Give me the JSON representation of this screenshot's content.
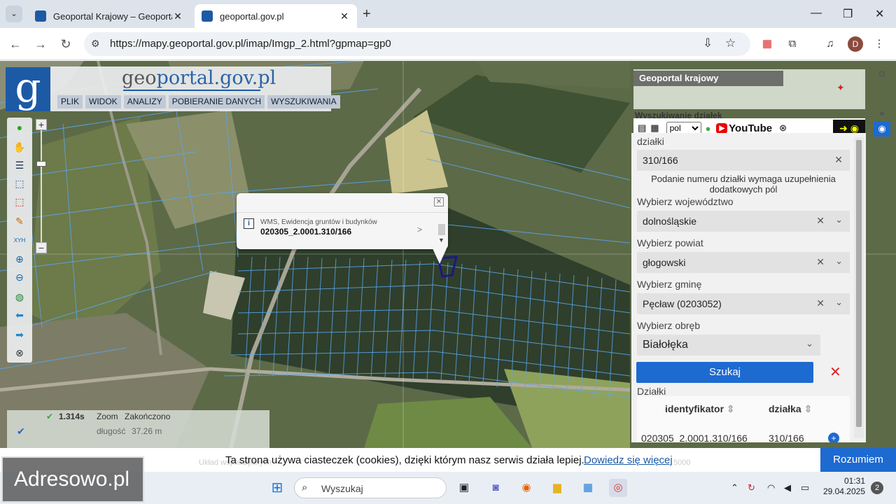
{
  "browser": {
    "tabs": [
      {
        "title": "Geoportal Krajowy – Geoportal",
        "active": false
      },
      {
        "title": "geoportal.gov.pl",
        "active": true
      }
    ],
    "url": "https://mapy.geoportal.gov.pl/imap/Imgp_2.html?gpmap=gp0",
    "profile_initial": "D"
  },
  "geoportal": {
    "logo_glyph": "g",
    "site_title_a": "geo",
    "site_title_b": "portal.gov.pl",
    "menu": [
      "PLIK",
      "WIDOK",
      "ANALIZY",
      "POBIERANIE DANYCH",
      "WYSZUKIWANIA"
    ]
  },
  "popup": {
    "source": "WMS, Ewidencja gruntów i budynków",
    "value": "020305_2.0001.310/166"
  },
  "status": {
    "time": "1.314s",
    "zoom_label": "Zoom",
    "zoom_state": "Zakończono",
    "length_label": "długość",
    "length_value": "37.26 m"
  },
  "right_panel": {
    "minimap_label": "Geoportal krajowy",
    "panel_title": "Wyszukiwanie działek",
    "lang_value": "pol",
    "youtube_label": "YouTube",
    "parcel_label": "działki",
    "parcel_value": "310/166",
    "hint": "Podanie numeru działki wymaga uzupełnienia dodatkowych pól",
    "voivodeship_label": "Wybierz województwo",
    "voivodeship_value": "dolnośląskie",
    "county_label": "Wybierz powiat",
    "county_value": "głogowski",
    "commune_label": "Wybierz gminę",
    "commune_value": "Pęcław (0203052)",
    "precinct_label": "Wybierz obręb",
    "precinct_value": "Białołęka",
    "search_label": "Szukaj",
    "results_label": "Działki",
    "columns": [
      "identyfikator",
      "działka"
    ],
    "row": [
      "020305_2.0001.310/166",
      "310/166"
    ]
  },
  "cookie": {
    "message": "Ta strona używa ciasteczek (cookies), dzięki którym nasz serwis działa lepiej.",
    "link": "Dowiedz się więcej",
    "accept": "Rozumiem",
    "faint_left": "Układ współrzędnych",
    "faint_right": "5000"
  },
  "taskbar": {
    "search_placeholder": "Wyszukaj",
    "time": "01:31",
    "date": "29.04.2025",
    "notifications": "2"
  },
  "watermark": "Adresowo.pl"
}
